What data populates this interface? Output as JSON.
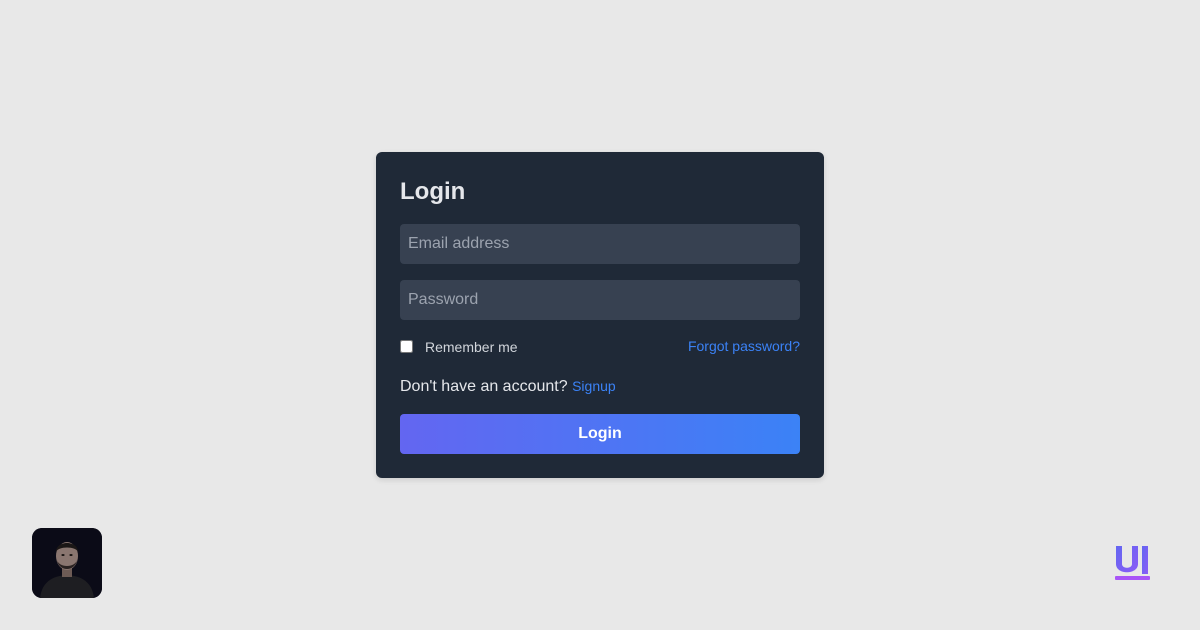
{
  "form": {
    "title": "Login",
    "email_placeholder": "Email address",
    "password_placeholder": "Password",
    "remember_label": "Remember me",
    "forgot_label": "Forgot password?",
    "signup_prompt": "Don't have an account?",
    "signup_label": "Signup",
    "login_button_label": "Login",
    "remember_checked": false
  },
  "branding": {
    "logo_text": "UI",
    "accent_colors": [
      "#6366f1",
      "#3b82f6",
      "#a855f7"
    ]
  },
  "colors": {
    "background": "#e8e8e8",
    "card": "#1f2937",
    "input": "#374151",
    "link": "#3b82f6"
  },
  "icons": {
    "avatar": "user-avatar-photo",
    "logo": "ui-logo-icon"
  }
}
